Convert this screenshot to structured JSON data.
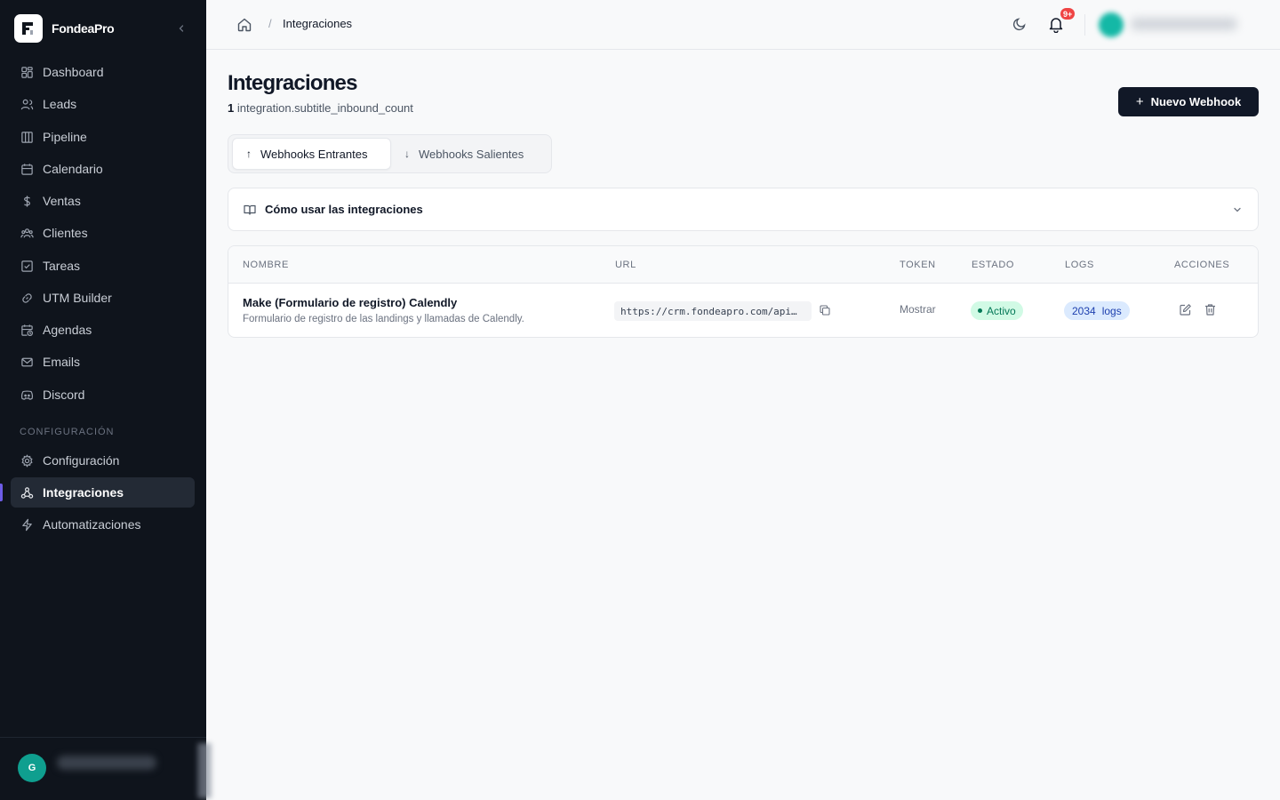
{
  "app": {
    "brand_name": "FondeaPro"
  },
  "sidebar": {
    "items": [
      {
        "label": "Dashboard",
        "icon": "grid-icon"
      },
      {
        "label": "Leads",
        "icon": "users-icon"
      },
      {
        "label": "Pipeline",
        "icon": "columns-icon"
      },
      {
        "label": "Calendario",
        "icon": "calendar-icon"
      },
      {
        "label": "Ventas",
        "icon": "dollar-icon"
      },
      {
        "label": "Clientes",
        "icon": "people-icon"
      },
      {
        "label": "Tareas",
        "icon": "checklist-icon"
      },
      {
        "label": "UTM Builder",
        "icon": "link-icon"
      },
      {
        "label": "Agendas",
        "icon": "calendar-clock-icon"
      },
      {
        "label": "Emails",
        "icon": "mail-icon"
      },
      {
        "label": "Discord",
        "icon": "discord-icon"
      }
    ],
    "section_label": "CONFIGURACIÓN",
    "config_items": [
      {
        "label": "Configuración",
        "icon": "gear-icon"
      },
      {
        "label": "Integraciones",
        "icon": "webhook-icon",
        "active": true
      },
      {
        "label": "Automatizaciones",
        "icon": "bolt-icon"
      }
    ],
    "footer": {
      "avatar_initial": "G"
    }
  },
  "topbar": {
    "breadcrumb_separator": "/",
    "breadcrumb_current": "Integraciones",
    "notification_badge": "9+"
  },
  "main": {
    "title": "Integraciones",
    "subtitle_count": "1",
    "subtitle_text": "integration.subtitle_inbound_count",
    "new_button_label": "Nuevo Webhook",
    "tabs": [
      {
        "label": "Webhooks Entrantes",
        "arrow": "↑",
        "active": true
      },
      {
        "label": "Webhooks Salientes",
        "arrow": "↓",
        "active": false
      }
    ],
    "accordion_label": "Cómo usar las integraciones",
    "table": {
      "headers": [
        "NOMBRE",
        "URL",
        "TOKEN",
        "ESTADO",
        "LOGS",
        "ACCIONES"
      ],
      "rows": [
        {
          "name": "Make (Formulario de registro) Calendly",
          "description": "Formulario de registro de las landings y llamadas de Calendly.",
          "url": "https://crm.fondeapro.com/api…",
          "token_action": "Mostrar",
          "status": "Activo",
          "logs_count": "2034",
          "logs_label": "logs"
        }
      ]
    }
  },
  "colors": {
    "sidebar_bg": "#0f141c",
    "accent": "#6d5ce7",
    "primary_button": "#111827",
    "status_active_bg": "#d1fae5",
    "status_active_fg": "#047857",
    "logs_bg": "#dbeafe",
    "logs_fg": "#1e40af",
    "badge": "#ef4444"
  }
}
